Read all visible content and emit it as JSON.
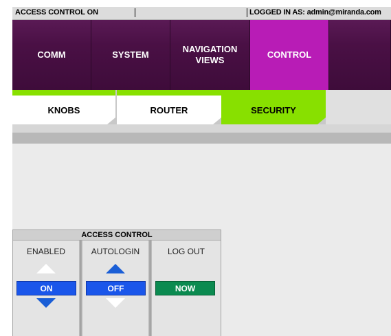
{
  "status_bar": {
    "left_text": "ACCESS CONTROL ON",
    "right_text": "LOGGED IN AS: admin@miranda.com"
  },
  "main_nav": {
    "tabs": [
      {
        "label": "COMM",
        "active": false
      },
      {
        "label": "SYSTEM",
        "active": false
      },
      {
        "label": "NAVIGATION\nVIEWS",
        "active": false
      },
      {
        "label": "CONTROL",
        "active": true
      }
    ]
  },
  "sub_nav": {
    "tabs": [
      {
        "label": "KNOBS",
        "active": false
      },
      {
        "label": "ROUTER",
        "active": false
      },
      {
        "label": "SECURITY",
        "active": true
      }
    ]
  },
  "access_control": {
    "title": "ACCESS CONTROL",
    "columns": [
      {
        "label": "ENABLED",
        "value": "ON",
        "up_enabled": false,
        "down_enabled": true
      },
      {
        "label": "AUTOLOGIN",
        "value": "OFF",
        "up_enabled": true,
        "down_enabled": false
      },
      {
        "label": "LOG OUT",
        "value": "NOW"
      }
    ]
  },
  "colors": {
    "nav_bg": "#4b1246",
    "nav_active": "#b81cb6",
    "sub_active": "#88e000",
    "value_blue": "#1a56ea",
    "value_green": "#0b8a50",
    "arrow_blue": "#1a5ed6"
  }
}
